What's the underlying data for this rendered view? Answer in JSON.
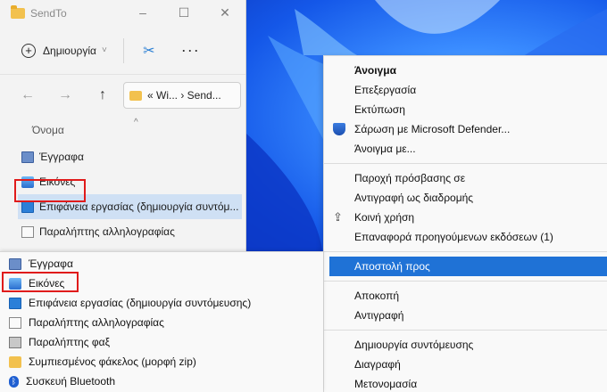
{
  "window": {
    "title": "SendTo",
    "controls": [
      "–",
      "☐",
      "✕"
    ]
  },
  "toolbar": {
    "new_label": "Δημιουργία",
    "new_chevron": "˅",
    "cut_glyph": "✂",
    "more_glyph": "···"
  },
  "nav": {
    "back": "←",
    "forward": "→",
    "up": "↑",
    "address": "« Wi... › Send..."
  },
  "list": {
    "column_header": "Όνομα",
    "sort_caret": "^",
    "items": [
      {
        "label": "Έγγραφα",
        "icon": "documents-icon"
      },
      {
        "label": "Εικόνες",
        "icon": "pictures-icon"
      },
      {
        "label": "Επιφάνεια εργασίας (δημιουργία συντόμ...",
        "icon": "desktop-icon"
      },
      {
        "label": "Παραλήπτης αλληλογραφίας",
        "icon": "mail-recipient-icon"
      }
    ]
  },
  "context_menu": {
    "group1": [
      "Άνοιγμα",
      "Επεξεργασία",
      "Εκτύπωση",
      "Σάρωση με Microsoft Defender...",
      "Άνοιγμα με..."
    ],
    "group2": [
      "Παροχή πρόσβασης σε",
      "Αντιγραφή ως διαδρομής",
      "Κοινή χρήση",
      "Επαναφορά προηγούμενων εκδόσεων (1)"
    ],
    "send_to": "Αποστολή προς",
    "group3": [
      "Αποκοπή",
      "Αντιγραφή"
    ],
    "group4": [
      "Δημιουργία συντόμευσης",
      "Διαγραφή",
      "Μετονομασία"
    ]
  },
  "send_to_menu": {
    "items": [
      {
        "label": "Έγγραφα",
        "icon": "documents-icon"
      },
      {
        "label": "Εικόνες",
        "icon": "pictures-icon"
      },
      {
        "label": "Επιφάνεια εργασίας (δημιουργία συντόμευσης)",
        "icon": "desktop-icon"
      },
      {
        "label": "Παραλήπτης αλληλογραφίας",
        "icon": "mail-recipient-icon"
      },
      {
        "label": "Παραλήπτης φαξ",
        "icon": "fax-recipient-icon"
      },
      {
        "label": "Συμπιεσμένος φάκελος (μορφή zip)",
        "icon": "zip-folder-icon"
      },
      {
        "label": "Συσκευή Bluetooth",
        "icon": "bluetooth-icon"
      }
    ]
  },
  "colors": {
    "highlight_box": "#e01b1b",
    "menu_active": "#1f72d6",
    "selected_row": "#cfe0f4"
  }
}
